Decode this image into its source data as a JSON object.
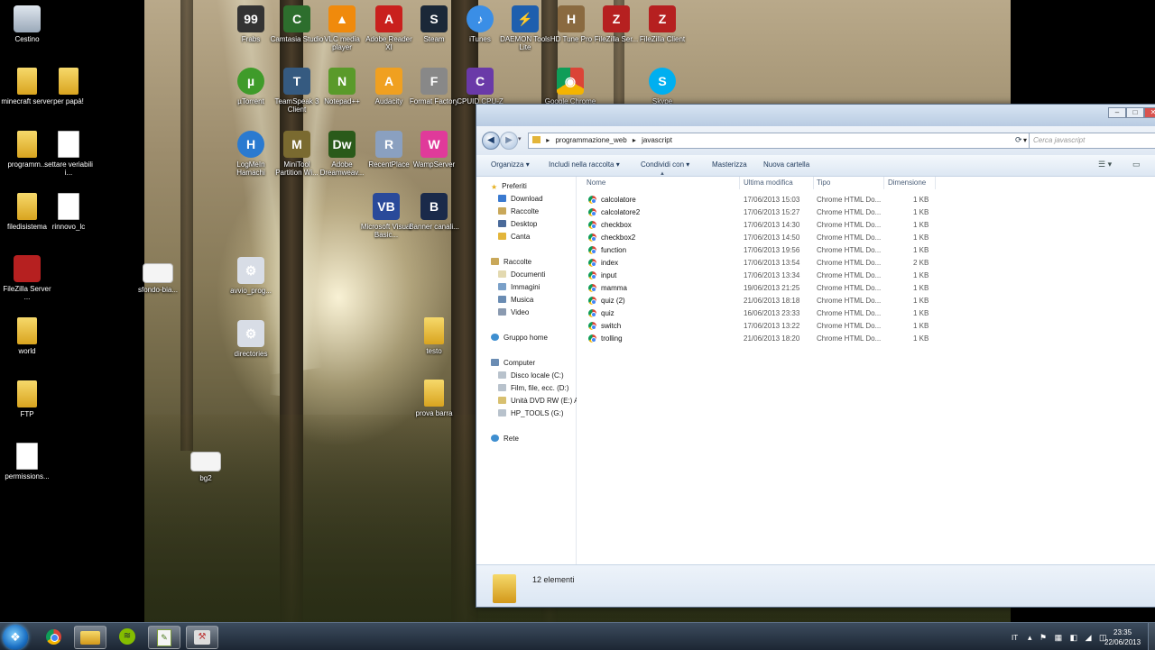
{
  "desktop_left": [
    {
      "label": "Cestino",
      "icon": "recycle-bin-icon"
    },
    {
      "label": "minecraft server",
      "icon": "folder-icon"
    },
    {
      "label": "per papà!",
      "icon": "folder-icon"
    },
    {
      "label": "programm...",
      "icon": "folder-icon"
    },
    {
      "label": "settare veriabili i...",
      "icon": "document-icon"
    },
    {
      "label": "filedisistema",
      "icon": "folder-icon"
    },
    {
      "label": "rinnovo_lc",
      "icon": "document-icon"
    },
    {
      "label": "FileZilla Server ...",
      "icon": "filezilla-icon"
    },
    {
      "label": "world",
      "icon": "folder-icon"
    },
    {
      "label": "FTP",
      "icon": "folder-icon"
    },
    {
      "label": "permissions...",
      "icon": "document-icon"
    }
  ],
  "desktop_main": [
    {
      "label": "Frabs",
      "icon": "fraps-icon",
      "glyph": "99"
    },
    {
      "label": "Camtasia Studio",
      "icon": "camtasia-icon",
      "glyph": "C"
    },
    {
      "label": "VLC media player",
      "icon": "vlc-icon",
      "glyph": "▲"
    },
    {
      "label": "Adobe Reader XI",
      "icon": "adobe-reader-icon",
      "glyph": "A"
    },
    {
      "label": "Steam",
      "icon": "steam-icon",
      "glyph": "S"
    },
    {
      "label": "iTunes",
      "icon": "itunes-icon",
      "glyph": "♪"
    },
    {
      "label": "DAEMON Tools Lite",
      "icon": "daemon-tools-icon",
      "glyph": "⚡"
    },
    {
      "label": "HD Tune Pro",
      "icon": "hdtune-icon",
      "glyph": "H"
    },
    {
      "label": "FileZilla Ser...",
      "icon": "filezilla-icon",
      "glyph": "Z"
    },
    {
      "label": "FileZilla Client",
      "icon": "filezilla-icon",
      "glyph": "Z"
    },
    {
      "label": "µTorrent",
      "icon": "utorrent-icon",
      "glyph": "µ"
    },
    {
      "label": "TeamSpeak 3 Client",
      "icon": "teamspeak-icon",
      "glyph": "T"
    },
    {
      "label": "Notepad++",
      "icon": "notepad-icon",
      "glyph": "N"
    },
    {
      "label": "Audacity",
      "icon": "audacity-icon",
      "glyph": "A"
    },
    {
      "label": "Format Factory",
      "icon": "format-factory-icon",
      "glyph": "F"
    },
    {
      "label": "CPUID CPU-Z",
      "icon": "cpuz-icon",
      "glyph": "C"
    },
    {
      "label": "Google Chrome",
      "icon": "chrome-icon",
      "glyph": "◉"
    },
    {
      "label": "Skype",
      "icon": "skype-icon",
      "glyph": "S"
    },
    {
      "label": "LogMeIn Hamachi",
      "icon": "hamachi-icon",
      "glyph": "H"
    },
    {
      "label": "MiniTool Partition Wi...",
      "icon": "minitool-icon",
      "glyph": "M"
    },
    {
      "label": "Adobe Dreamweav...",
      "icon": "dreamweaver-icon",
      "glyph": "Dw"
    },
    {
      "label": "RecentPlace",
      "icon": "recentplace-icon",
      "glyph": "R"
    },
    {
      "label": "WampServer",
      "icon": "wampserver-icon",
      "glyph": "W"
    },
    {
      "label": "Microsoft Visual Basic...",
      "icon": "visual-basic-icon",
      "glyph": "VB"
    },
    {
      "label": "Banner canali...",
      "icon": "banner-icon",
      "glyph": "B"
    },
    {
      "label": "sfondo-bia...",
      "icon": "image-icon",
      "glyph": ""
    },
    {
      "label": "avvio_prog...",
      "icon": "config-icon",
      "glyph": "⚙"
    },
    {
      "label": "directories",
      "icon": "config-icon",
      "glyph": "⚙"
    },
    {
      "label": "testo",
      "icon": "folder-icon",
      "glyph": ""
    },
    {
      "label": "prova barra",
      "icon": "folder-icon",
      "glyph": ""
    },
    {
      "label": "bg2",
      "icon": "image-icon",
      "glyph": ""
    }
  ],
  "explorer": {
    "breadcrumb": [
      "programmazione_web",
      "javascript"
    ],
    "search_placeholder": "Cerca javascript",
    "toolbar": {
      "organize": "Organizza",
      "include": "Includi nella raccolta",
      "share": "Condividi con",
      "burn": "Masterizza",
      "new_folder": "Nuova cartella"
    },
    "nav": {
      "favorites": "Preferiti",
      "fav_items": [
        "Download",
        "Raccolte",
        "Desktop",
        "Canta"
      ],
      "libraries": "Raccolte",
      "lib_items": [
        "Documenti",
        "Immagini",
        "Musica",
        "Video"
      ],
      "homegroup": "Gruppo home",
      "computer": "Computer",
      "drives": [
        "Disco locale (C:)",
        "Film, file, ecc. (D:)",
        "Unità DVD RW (E:) A",
        "HP_TOOLS (G:)"
      ],
      "network": "Rete"
    },
    "columns": {
      "name": "Nome",
      "modified": "Ultima modifica",
      "type": "Tipo",
      "size": "Dimensione"
    },
    "files": [
      {
        "name": "calcolatore",
        "modified": "17/06/2013 15:03",
        "type": "Chrome HTML Do...",
        "size": "1 KB"
      },
      {
        "name": "calcolatore2",
        "modified": "17/06/2013 15:27",
        "type": "Chrome HTML Do...",
        "size": "1 KB"
      },
      {
        "name": "checkbox",
        "modified": "17/06/2013 14:30",
        "type": "Chrome HTML Do...",
        "size": "1 KB"
      },
      {
        "name": "checkbox2",
        "modified": "17/06/2013 14:50",
        "type": "Chrome HTML Do...",
        "size": "1 KB"
      },
      {
        "name": "function",
        "modified": "17/06/2013 19:56",
        "type": "Chrome HTML Do...",
        "size": "1 KB"
      },
      {
        "name": "index",
        "modified": "17/06/2013 13:54",
        "type": "Chrome HTML Do...",
        "size": "2 KB"
      },
      {
        "name": "input",
        "modified": "17/06/2013 13:34",
        "type": "Chrome HTML Do...",
        "size": "1 KB"
      },
      {
        "name": "mamma",
        "modified": "19/06/2013 21:25",
        "type": "Chrome HTML Do...",
        "size": "1 KB"
      },
      {
        "name": "quiz (2)",
        "modified": "21/06/2013 18:18",
        "type": "Chrome HTML Do...",
        "size": "1 KB"
      },
      {
        "name": "quiz",
        "modified": "16/06/2013 23:33",
        "type": "Chrome HTML Do...",
        "size": "1 KB"
      },
      {
        "name": "switch",
        "modified": "17/06/2013 13:22",
        "type": "Chrome HTML Do...",
        "size": "1 KB"
      },
      {
        "name": "trolling",
        "modified": "21/06/2013 18:20",
        "type": "Chrome HTML Do...",
        "size": "1 KB"
      }
    ],
    "status": "12 elementi"
  },
  "taskbar": {
    "apps": [
      "chrome-icon",
      "explorer-icon",
      "spotify-icon",
      "notepad-icon",
      "tools-icon"
    ],
    "lang": "IT",
    "time": "23:35",
    "date": "22/06/2013"
  }
}
